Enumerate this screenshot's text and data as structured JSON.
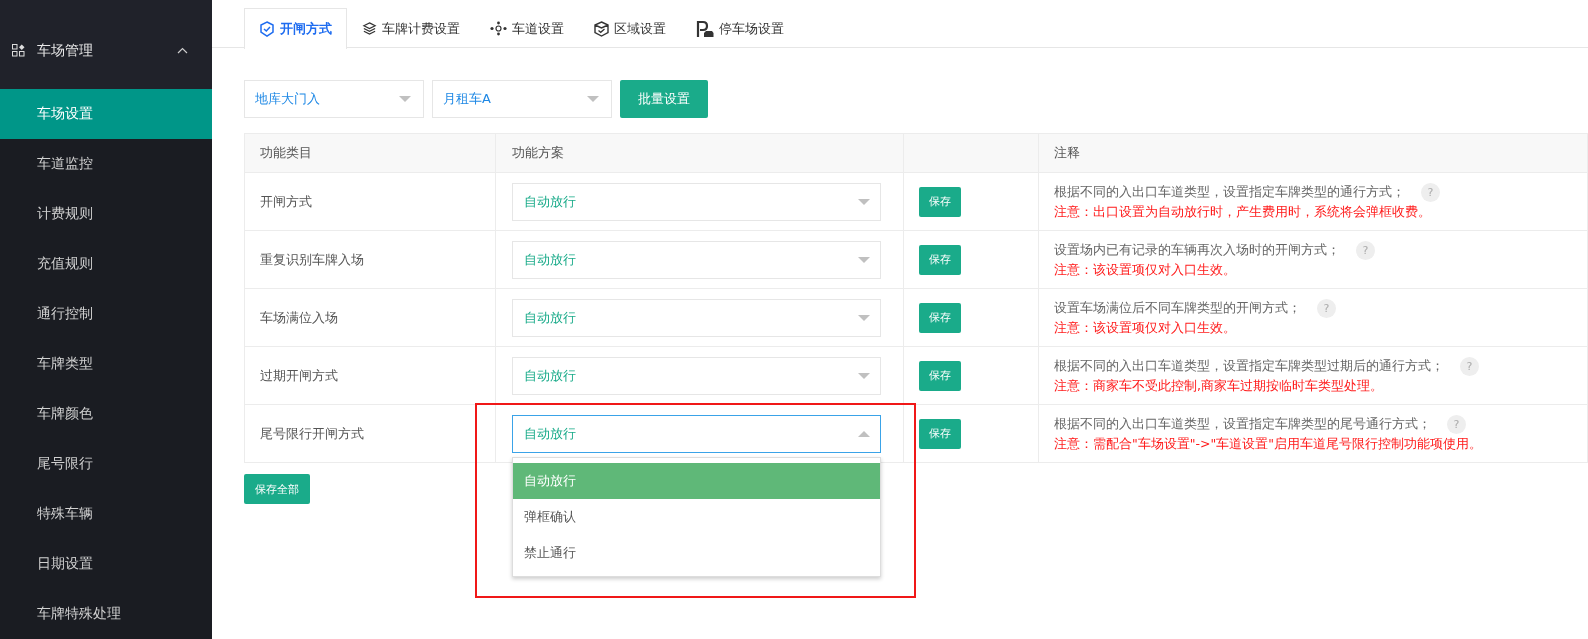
{
  "sidebar": {
    "group": {
      "label": "车场管理",
      "expanded": true
    },
    "items": [
      {
        "label": "车场设置",
        "selected": true
      },
      {
        "label": "车道监控",
        "selected": false
      },
      {
        "label": "计费规则",
        "selected": false
      },
      {
        "label": "充值规则",
        "selected": false
      },
      {
        "label": "通行控制",
        "selected": false
      },
      {
        "label": "车牌类型",
        "selected": false
      },
      {
        "label": "车牌颜色",
        "selected": false
      },
      {
        "label": "尾号限行",
        "selected": false
      },
      {
        "label": "特殊车辆",
        "selected": false
      },
      {
        "label": "日期设置",
        "selected": false
      },
      {
        "label": "车牌特殊处理",
        "selected": false
      }
    ]
  },
  "tabs": [
    {
      "label": "开闸方式",
      "selected": true
    },
    {
      "label": "车牌计费设置",
      "selected": false
    },
    {
      "label": "车道设置",
      "selected": false
    },
    {
      "label": "区域设置",
      "selected": false
    },
    {
      "label": "停车场设置",
      "selected": false
    }
  ],
  "filters": [
    {
      "value": "地库大门入"
    },
    {
      "value": "月租车A"
    }
  ],
  "batch_button": "批量设置",
  "table": {
    "columns": [
      "功能类目",
      "功能方案",
      "注释"
    ],
    "rows": [
      {
        "category": "开闸方式",
        "plan": "自动放行",
        "button": "保存",
        "note": "根据不同的入出口车道类型，设置指定车牌类型的通行方式；",
        "warning": "注意：出口设置为自动放行时，产生费用时，系统将会弹框收费。",
        "open": false
      },
      {
        "category": "重复识别车牌入场",
        "plan": "自动放行",
        "button": "保存",
        "note": "设置场内已有记录的车辆再次入场时的开闸方式；",
        "warning": "注意：该设置项仅对入口生效。",
        "open": false
      },
      {
        "category": "车场满位入场",
        "plan": "自动放行",
        "button": "保存",
        "note": "设置车场满位后不同车牌类型的开闸方式；",
        "warning": "注意：该设置项仅对入口生效。",
        "open": false
      },
      {
        "category": "过期开闸方式",
        "plan": "自动放行",
        "button": "保存",
        "note": "根据不同的入出口车道类型，设置指定车牌类型过期后的通行方式；",
        "warning": "注意：商家车不受此控制,商家车过期按临时车类型处理。",
        "open": false
      },
      {
        "category": "尾号限行开闸方式",
        "plan": "自动放行",
        "button": "保存",
        "note": "根据不同的入出口车道类型，设置指定车牌类型的尾号通行方式；",
        "warning": "注意：需配合\"车场设置\"->\"车道设置\"启用车道尾号限行控制功能项使用。",
        "open": true,
        "options": [
          {
            "label": "自动放行",
            "selected": true
          },
          {
            "label": "弹框确认",
            "selected": false
          },
          {
            "label": "禁止通行",
            "selected": false
          }
        ]
      }
    ]
  },
  "save_all_button": "保存全部",
  "help_mark": "?"
}
